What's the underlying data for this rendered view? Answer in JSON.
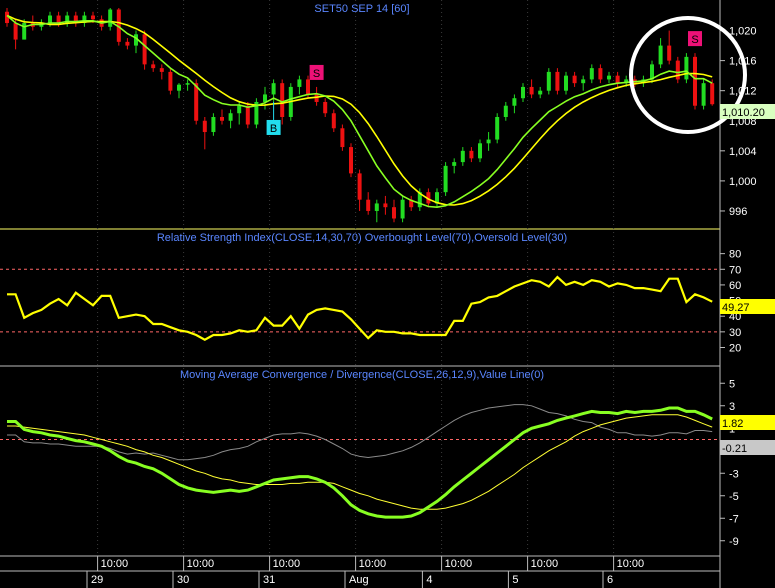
{
  "chart_data": [
    {
      "type": "candlestick",
      "title": "SET50 SEP 14   [60]",
      "y_ticks": [
        1020,
        1016,
        1012,
        1008,
        1004,
        1000,
        996
      ],
      "y_tick_labels": [
        "1,020",
        "1,016",
        "1,012",
        "1,008",
        "1,004",
        "1,000",
        "996"
      ],
      "ylim": [
        994,
        1023
      ],
      "last_value_label": "1,010.20",
      "colors": {
        "up": "#22dd22",
        "down": "#ee1111",
        "ma_fast": "#88ff22",
        "ma_slow": "#ffff00",
        "buy": "#22ddee",
        "sell": "#ee1177"
      },
      "candles": [
        [
          1022.5,
          1023.0,
          1020.5,
          1021.0
        ],
        [
          1021.0,
          1021.5,
          1017.5,
          1018.8
        ],
        [
          1018.8,
          1021.5,
          1018.8,
          1021.0
        ],
        [
          1021.0,
          1022.0,
          1020.0,
          1020.5
        ],
        [
          1020.5,
          1021.5,
          1020.0,
          1021.0
        ],
        [
          1021.0,
          1022.5,
          1020.5,
          1022.0
        ],
        [
          1022.0,
          1022.5,
          1020.5,
          1021.0
        ],
        [
          1021.0,
          1022.5,
          1020.5,
          1022.0
        ],
        [
          1022.0,
          1022.5,
          1020.5,
          1021.0
        ],
        [
          1021.0,
          1022.5,
          1020.5,
          1022.0
        ],
        [
          1022.0,
          1022.5,
          1021.0,
          1021.5
        ],
        [
          1021.5,
          1022.0,
          1020.0,
          1020.5
        ],
        [
          1020.5,
          1023.0,
          1020.0,
          1022.8
        ],
        [
          1022.8,
          1023.0,
          1018.0,
          1018.5
        ],
        [
          1018.5,
          1019.0,
          1017.5,
          1018.0
        ],
        [
          1018.0,
          1020.0,
          1017.0,
          1019.5
        ],
        [
          1019.5,
          1020.0,
          1014.8,
          1015.5
        ],
        [
          1015.5,
          1016.0,
          1014.5,
          1015.0
        ],
        [
          1015.0,
          1015.5,
          1013.5,
          1014.5
        ],
        [
          1014.5,
          1015.0,
          1011.5,
          1012.0
        ],
        [
          1012.0,
          1013.0,
          1011.0,
          1012.8
        ],
        [
          1012.8,
          1013.5,
          1012.0,
          1013.0
        ],
        [
          1013.0,
          1013.5,
          1007.5,
          1008.0
        ],
        [
          1008.0,
          1008.5,
          1004.2,
          1006.5
        ],
        [
          1006.5,
          1009.0,
          1006.0,
          1008.5
        ],
        [
          1008.5,
          1009.5,
          1007.5,
          1008.0
        ],
        [
          1008.0,
          1009.5,
          1007.0,
          1009.0
        ],
        [
          1009.0,
          1010.5,
          1007.5,
          1010.0
        ],
        [
          1010.0,
          1010.5,
          1007.0,
          1007.5
        ],
        [
          1007.5,
          1011.0,
          1007.0,
          1010.5
        ],
        [
          1010.5,
          1012.5,
          1009.5,
          1011.5
        ],
        [
          1011.5,
          1013.5,
          1010.5,
          1013.0
        ],
        [
          1013.0,
          1013.5,
          1007.5,
          1008.5
        ],
        [
          1008.5,
          1013.0,
          1008.0,
          1012.5
        ],
        [
          1012.5,
          1014.0,
          1011.5,
          1013.5
        ],
        [
          1013.5,
          1014.0,
          1011.0,
          1011.5
        ],
        [
          1011.5,
          1012.5,
          1010.0,
          1010.5
        ],
        [
          1010.5,
          1011.0,
          1008.5,
          1009.0
        ],
        [
          1009.0,
          1009.5,
          1006.5,
          1007.0
        ],
        [
          1007.0,
          1007.5,
          1004.0,
          1004.5
        ],
        [
          1004.5,
          1005.0,
          1000.5,
          1001.0
        ],
        [
          1001.0,
          1001.5,
          996.0,
          997.5
        ],
        [
          997.5,
          998.5,
          995.5,
          996.0
        ],
        [
          996.0,
          997.5,
          994.5,
          997.0
        ],
        [
          997.0,
          998.0,
          995.5,
          996.5
        ],
        [
          996.5,
          997.5,
          994.5,
          995.0
        ],
        [
          995.0,
          998.0,
          994.5,
          997.5
        ],
        [
          997.5,
          998.0,
          996.0,
          996.5
        ],
        [
          996.5,
          999.0,
          996.0,
          998.5
        ],
        [
          998.5,
          999.0,
          996.5,
          997.0
        ],
        [
          997.0,
          999.0,
          996.5,
          998.5
        ],
        [
          998.5,
          1002.5,
          998.0,
          1002.0
        ],
        [
          1002.0,
          1003.0,
          1001.0,
          1002.5
        ],
        [
          1002.5,
          1004.5,
          1002.0,
          1004.0
        ],
        [
          1004.0,
          1004.5,
          1002.5,
          1003.0
        ],
        [
          1003.0,
          1005.5,
          1002.5,
          1005.0
        ],
        [
          1005.0,
          1006.5,
          1004.0,
          1005.5
        ],
        [
          1005.5,
          1009.0,
          1005.0,
          1008.5
        ],
        [
          1008.5,
          1010.5,
          1008.0,
          1010.0
        ],
        [
          1010.0,
          1011.5,
          1009.0,
          1011.0
        ],
        [
          1011.0,
          1013.0,
          1010.5,
          1012.5
        ],
        [
          1012.5,
          1013.5,
          1011.0,
          1011.5
        ],
        [
          1011.5,
          1012.5,
          1011.0,
          1012.0
        ],
        [
          1012.0,
          1015.0,
          1011.5,
          1014.5
        ],
        [
          1014.5,
          1015.0,
          1011.5,
          1012.0
        ],
        [
          1012.0,
          1014.5,
          1011.5,
          1014.0
        ],
        [
          1014.0,
          1014.5,
          1012.5,
          1013.0
        ],
        [
          1013.0,
          1014.0,
          1012.0,
          1013.5
        ],
        [
          1013.5,
          1015.5,
          1013.0,
          1015.0
        ],
        [
          1015.0,
          1015.5,
          1013.0,
          1013.5
        ],
        [
          1013.5,
          1014.5,
          1013.0,
          1014.0
        ],
        [
          1014.0,
          1014.5,
          1012.5,
          1013.0
        ],
        [
          1013.0,
          1014.0,
          1012.5,
          1013.5
        ],
        [
          1013.5,
          1014.0,
          1012.5,
          1013.0
        ],
        [
          1013.0,
          1014.0,
          1012.5,
          1013.5
        ],
        [
          1013.5,
          1016.0,
          1013.0,
          1015.5
        ],
        [
          1015.5,
          1019.0,
          1015.0,
          1018.0
        ],
        [
          1018.0,
          1020.0,
          1015.5,
          1016.0
        ],
        [
          1016.0,
          1016.5,
          1013.0,
          1013.5
        ],
        [
          1013.5,
          1017.0,
          1013.0,
          1016.5
        ],
        [
          1016.5,
          1017.0,
          1009.5,
          1010.0
        ],
        [
          1010.0,
          1013.5,
          1009.5,
          1013.0
        ],
        [
          1013.0,
          1013.5,
          1010.0,
          1010.2
        ]
      ],
      "ma_fast": [
        1022.0,
        1021.0,
        1020.5,
        1020.8,
        1020.8,
        1021.0,
        1021.0,
        1021.2,
        1021.2,
        1021.3,
        1021.3,
        1021.0,
        1021.2,
        1020.5,
        1019.6,
        1019.0,
        1018.0,
        1017.0,
        1016.0,
        1015.0,
        1014.2,
        1013.7,
        1012.6,
        1011.4,
        1010.8,
        1010.3,
        1010.1,
        1010.1,
        1009.8,
        1010.0,
        1010.4,
        1011.0,
        1010.5,
        1010.9,
        1011.2,
        1011.5,
        1011.6,
        1011.3,
        1010.6,
        1009.5,
        1008.0,
        1006.0,
        1004.0,
        1002.0,
        1000.4,
        998.9,
        998.0,
        997.4,
        997.0,
        996.6,
        996.5,
        996.7,
        997.2,
        997.9,
        998.6,
        999.4,
        1000.3,
        1001.5,
        1002.9,
        1004.3,
        1005.8,
        1007.0,
        1008.1,
        1009.2,
        1009.9,
        1010.6,
        1011.2,
        1011.6,
        1012.1,
        1012.5,
        1012.8,
        1013.0,
        1013.1,
        1013.2,
        1013.3,
        1013.6,
        1014.2,
        1014.6,
        1014.4,
        1014.6,
        1013.6,
        1013.6,
        1013.0
      ]
    },
    {
      "type": "line",
      "title": "Relative Strength Index(CLOSE,14,30,70) Overbought Level(70),Oversold Level(30)",
      "y_ticks": [
        80,
        70,
        60,
        50,
        40,
        30,
        20
      ],
      "ylim": [
        12,
        90
      ],
      "reference_lines": [
        70,
        30
      ],
      "last_value_label": "49.27",
      "values": [
        54,
        54,
        39,
        42,
        44,
        48,
        51,
        47,
        55,
        51,
        47,
        53,
        53,
        39,
        40,
        41,
        40,
        35,
        35,
        33,
        31,
        30,
        28,
        25,
        28,
        28,
        29,
        31,
        30,
        31,
        39,
        34,
        34,
        40,
        32,
        41,
        44,
        45,
        44,
        43,
        38,
        32,
        26,
        31,
        30,
        30,
        29,
        29,
        28,
        28,
        28,
        28,
        37,
        37,
        48,
        49,
        52,
        53,
        56,
        59,
        61,
        63,
        62,
        59,
        65,
        60,
        62,
        60,
        63,
        62,
        59,
        61,
        60,
        58,
        58,
        57,
        56,
        64,
        64,
        49,
        54,
        52,
        49.27
      ]
    },
    {
      "type": "line",
      "title": "Moving Average Convergence / Divergence(CLOSE,26,12,9),Value Line(0)",
      "y_ticks": [
        5,
        3,
        1,
        -1,
        -3,
        -5,
        -7,
        -9
      ],
      "ylim": [
        -10,
        6
      ],
      "reference_lines": [
        0
      ],
      "last_value_label": "1.82",
      "signal_value_label": "-0.21",
      "series": [
        {
          "name": "MACD",
          "values": [
            1.6,
            1.6,
            0.9,
            0.7,
            0.6,
            0.4,
            0.3,
            0.1,
            -0.1,
            -0.2,
            -0.4,
            -0.6,
            -1.0,
            -1.5,
            -1.9,
            -2.1,
            -2.4,
            -2.6,
            -3.0,
            -3.5,
            -4.0,
            -4.3,
            -4.5,
            -4.6,
            -4.7,
            -4.6,
            -4.5,
            -4.6,
            -4.5,
            -4.2,
            -3.9,
            -3.6,
            -3.5,
            -3.4,
            -3.3,
            -3.3,
            -3.5,
            -3.8,
            -4.3,
            -5.0,
            -5.8,
            -6.3,
            -6.6,
            -6.8,
            -6.9,
            -6.9,
            -6.9,
            -6.8,
            -6.5,
            -6.0,
            -5.5,
            -4.9,
            -4.2,
            -3.6,
            -3.0,
            -2.4,
            -1.8,
            -1.2,
            -0.6,
            0.0,
            0.6,
            1.0,
            1.2,
            1.4,
            1.7,
            1.9,
            2.1,
            2.3,
            2.5,
            2.4,
            2.4,
            2.3,
            2.5,
            2.4,
            2.5,
            2.5,
            2.6,
            2.8,
            2.8,
            2.5,
            2.5,
            2.2,
            1.82
          ]
        },
        {
          "name": "Signal",
          "values": [
            1.2,
            1.2,
            1.1,
            1.0,
            0.9,
            0.8,
            0.7,
            0.6,
            0.5,
            0.4,
            0.2,
            0.0,
            -0.2,
            -0.4,
            -0.6,
            -0.9,
            -1.1,
            -1.4,
            -1.6,
            -1.9,
            -2.2,
            -2.5,
            -2.8,
            -3.0,
            -3.3,
            -3.5,
            -3.6,
            -3.8,
            -3.9,
            -4.0,
            -4.0,
            -4.0,
            -4.0,
            -3.9,
            -3.9,
            -3.8,
            -3.8,
            -3.8,
            -3.9,
            -4.2,
            -4.5,
            -4.8,
            -5.0,
            -5.3,
            -5.5,
            -5.7,
            -5.9,
            -6.1,
            -6.2,
            -6.2,
            -6.2,
            -6.1,
            -5.9,
            -5.7,
            -5.4,
            -5.0,
            -4.6,
            -4.1,
            -3.6,
            -3.1,
            -2.5,
            -2.0,
            -1.5,
            -1.0,
            -0.6,
            -0.2,
            0.3,
            0.7,
            1.0,
            1.3,
            1.5,
            1.7,
            1.9,
            2.0,
            2.1,
            2.2,
            2.2,
            2.2,
            2.2,
            2.0,
            1.7,
            1.4,
            1.1
          ]
        },
        {
          "name": "Histogram",
          "values": [
            0.4,
            0.4,
            -0.2,
            -0.3,
            -0.3,
            -0.4,
            -0.4,
            -0.5,
            -0.6,
            -0.6,
            -0.6,
            -0.6,
            -0.8,
            -1.1,
            -1.3,
            -1.2,
            -1.3,
            -1.2,
            -1.4,
            -1.6,
            -1.8,
            -1.8,
            -1.7,
            -1.6,
            -1.4,
            -1.1,
            -0.9,
            -0.8,
            -0.6,
            -0.2,
            0.1,
            0.4,
            0.5,
            0.5,
            0.6,
            0.5,
            0.3,
            0.0,
            -0.4,
            -0.8,
            -1.3,
            -1.5,
            -1.6,
            -1.5,
            -1.4,
            -1.2,
            -1.0,
            -0.7,
            -0.3,
            0.2,
            0.7,
            1.2,
            1.7,
            2.1,
            2.4,
            2.6,
            2.8,
            2.9,
            3.0,
            3.1,
            3.1,
            3.0,
            2.7,
            2.4,
            2.3,
            2.1,
            1.8,
            1.6,
            1.5,
            1.1,
            0.9,
            0.6,
            0.6,
            0.4,
            0.4,
            0.3,
            0.4,
            0.6,
            0.6,
            0.5,
            0.8,
            0.8,
            0.7
          ]
        }
      ]
    }
  ],
  "signals": [
    {
      "label": "B",
      "type": "buy",
      "bar": 31
    },
    {
      "label": "S",
      "type": "sell",
      "bar": 36
    },
    {
      "label": "S",
      "type": "sell",
      "bar": 80
    }
  ],
  "time_axis": {
    "time_labels": [
      {
        "bar": 11,
        "text": "10:00"
      },
      {
        "bar": 21,
        "text": "10:00"
      },
      {
        "bar": 31,
        "text": "10:00"
      },
      {
        "bar": 41,
        "text": "10:00"
      },
      {
        "bar": 51,
        "text": "10:00"
      },
      {
        "bar": 61,
        "text": "10:00"
      },
      {
        "bar": 71,
        "text": "10:00"
      }
    ],
    "date_labels": [
      {
        "bar": 10,
        "text": "29"
      },
      {
        "bar": 20,
        "text": "30"
      },
      {
        "bar": 30,
        "text": "31"
      },
      {
        "bar": 40,
        "text": "Aug"
      },
      {
        "bar": 49,
        "text": "4"
      },
      {
        "bar": 59,
        "text": "5"
      },
      {
        "bar": 70,
        "text": "6"
      }
    ]
  }
}
